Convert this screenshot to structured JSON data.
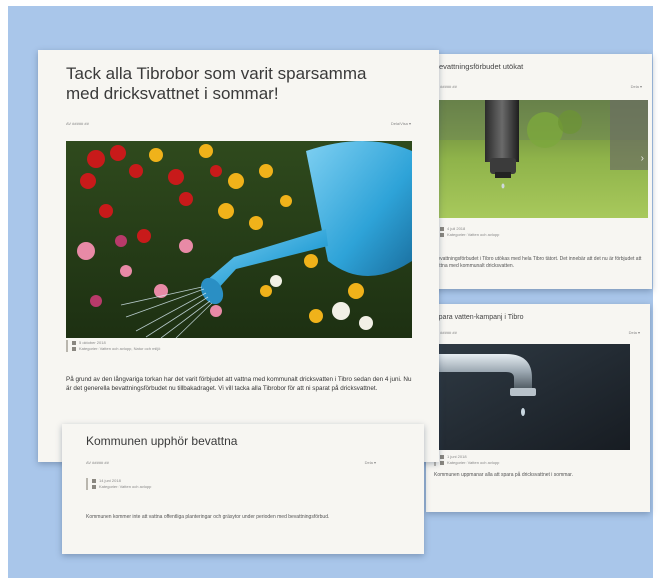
{
  "cards": {
    "main": {
      "title": "Tack alla Tibrobor som varit sparsamma med dricksvattnet i sommar!",
      "byline": "AV ##### ##",
      "share_label": "Dela/Visa ▾",
      "date": "5 oktober 2018",
      "tags": "Kategorier: Vatten och avlopp, Natur och miljö",
      "body": "På grund av den långvariga torkan har det varit förbjudet att vattna med kommunalt dricksvatten i Tibro sedan den 4 juni. Nu är det generella bevattningsförbudet nu tillbakadraget. Vi vill tacka alla Tibrobor för att ni sparat på dricksvattnet."
    },
    "top_right": {
      "title": "Bevattningsförbudet utökat",
      "byline": "AV ##### ##",
      "share_label": "Dela ▾",
      "date": "4 juli 2018",
      "tags": "Kategorier: Vatten och avlopp",
      "body": "Bevattningsförbudet i Tibro utökas med hela Tibro tätort. Det innebär att det nu är förbjudet att vattna med kommunalt dricksvatten."
    },
    "bottom_right": {
      "title": "Spara vatten-kampanj i Tibro",
      "byline": "AV ##### ##",
      "share_label": "Dela ▾",
      "date": "1 juni 2018",
      "tags": "Kategorier: Vatten och avlopp",
      "body": "Kommunen uppmanar alla att spara på dricksvattnet i sommar."
    },
    "bottom_left": {
      "title": "Kommunen upphör bevattna",
      "byline": "AV ##### ##",
      "share_label": "Dela ▾",
      "date": "14 juni 2018",
      "tags": "Kategorier: Vatten och avlopp",
      "body": "Kommunen kommer inte att vattna offentliga planteringar och gräsytor under perioden med bevattningsförbud."
    }
  },
  "colors": {
    "background": "#a9c6ea",
    "card": "#f7f6f2",
    "title_text": "#3a3a3a",
    "body_text": "#333333"
  },
  "icons": {
    "carousel_prev": "chevron-left-icon",
    "carousel_next": "chevron-right-icon",
    "date": "calendar-icon",
    "tags": "tag-icon"
  }
}
